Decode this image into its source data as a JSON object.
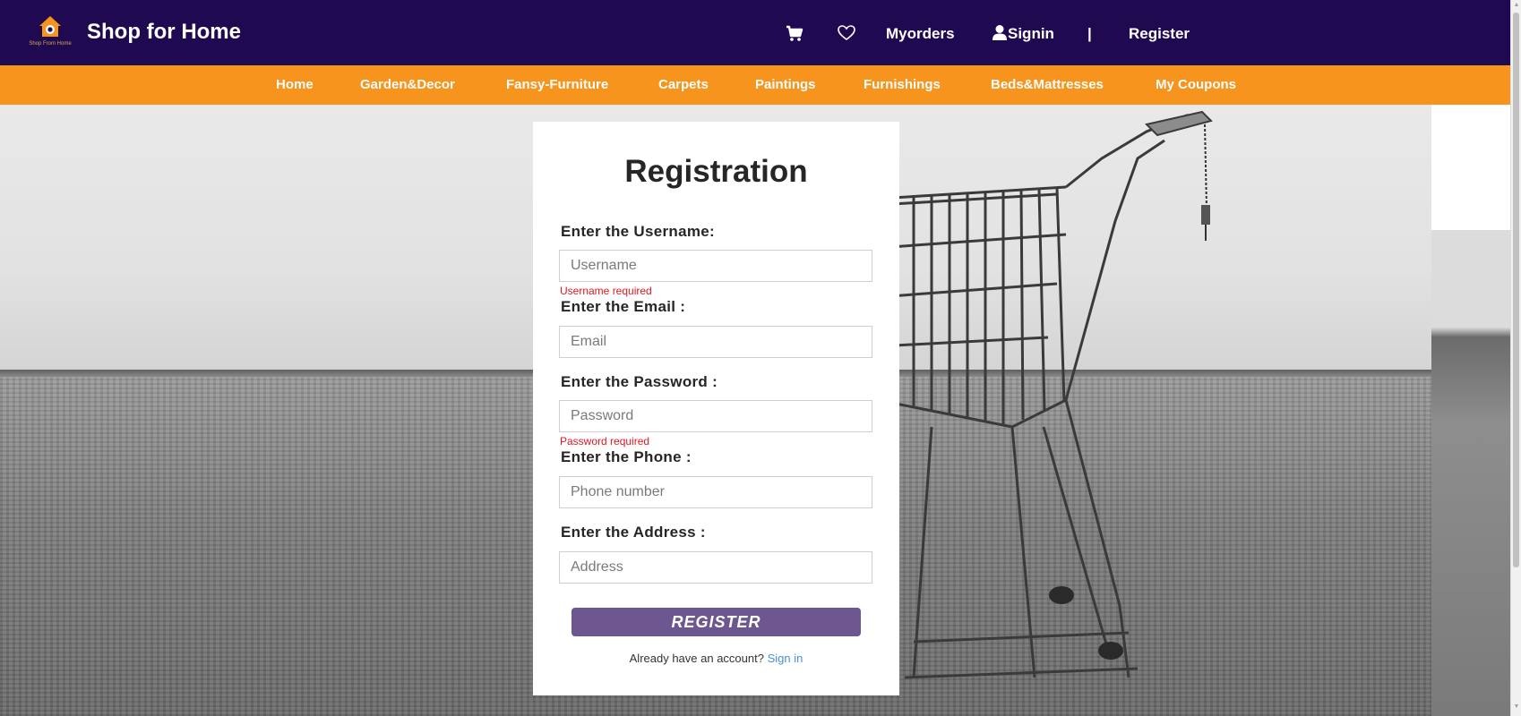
{
  "brand": {
    "title": "Shop for Home",
    "logo_caption": "Shop From Home",
    "logo_color": "#f7941d"
  },
  "topnav": {
    "cart_icon": "cart-icon",
    "wishlist_icon": "heart-icon",
    "myorders": "Myorders",
    "signin_icon": "user-icon",
    "signin": "Signin",
    "separator": "|",
    "register": "Register"
  },
  "categories": [
    "Home",
    "Garden&Decor",
    "Fansy-Furniture",
    "Carpets",
    "Paintings",
    "Furnishings",
    "Beds&Mattresses",
    "My Coupons"
  ],
  "form": {
    "title": "Registration",
    "username_label": "Enter the Username:",
    "username_placeholder": "Username",
    "username_value": "",
    "username_error": "Username required",
    "email_label": "Enter the Email :",
    "email_placeholder": "Email",
    "email_value": "",
    "password_label": "Enter the Password :",
    "password_placeholder": "Password",
    "password_value": "",
    "password_error": "Password required",
    "phone_label": "Enter the Phone :",
    "phone_placeholder": "Phone number",
    "phone_value": "",
    "address_label": "Enter the Address :",
    "address_placeholder": "Address",
    "address_value": "",
    "submit_label": "REGISTER",
    "already_text": "Already have an account?",
    "signin_link": "Sign in"
  },
  "colors": {
    "navbar": "#1f0a52",
    "category_bar": "#f7941d",
    "button": "#6e5791",
    "error": "#e0171f",
    "link": "#4a8fd8"
  }
}
